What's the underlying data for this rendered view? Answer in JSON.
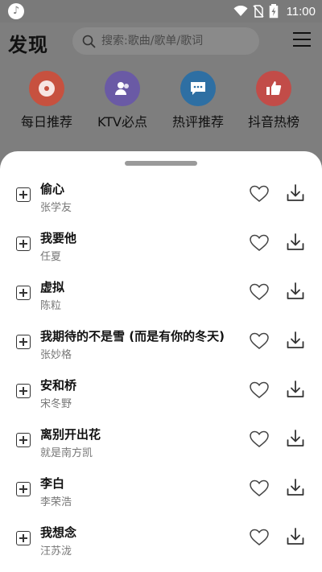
{
  "status_bar": {
    "time": "11:00"
  },
  "header": {
    "title": "发现",
    "search_placeholder": "搜索:歌曲/歌单/歌词"
  },
  "categories": [
    {
      "label": "每日推荐",
      "color": "#c7513f",
      "icon": "record-icon"
    },
    {
      "label": "KTV必点",
      "color": "#6a5aa5",
      "icon": "user-group-icon"
    },
    {
      "label": "热评推荐",
      "color": "#2e6fa3",
      "icon": "comment-icon"
    },
    {
      "label": "抖音热榜",
      "color": "#c24c48",
      "icon": "thumbs-up-icon"
    }
  ],
  "songs": [
    {
      "title": "偷心",
      "artist": "张学友"
    },
    {
      "title": "我要他",
      "artist": "任夏"
    },
    {
      "title": "虚拟",
      "artist": "陈粒"
    },
    {
      "title": "我期待的不是雪 (而是有你的冬天)",
      "artist": "张妙格"
    },
    {
      "title": "安和桥",
      "artist": "宋冬野"
    },
    {
      "title": "离别开出花",
      "artist": "就是南方凯"
    },
    {
      "title": "李白",
      "artist": "李荣浩"
    },
    {
      "title": "我想念",
      "artist": "汪苏泷"
    }
  ]
}
